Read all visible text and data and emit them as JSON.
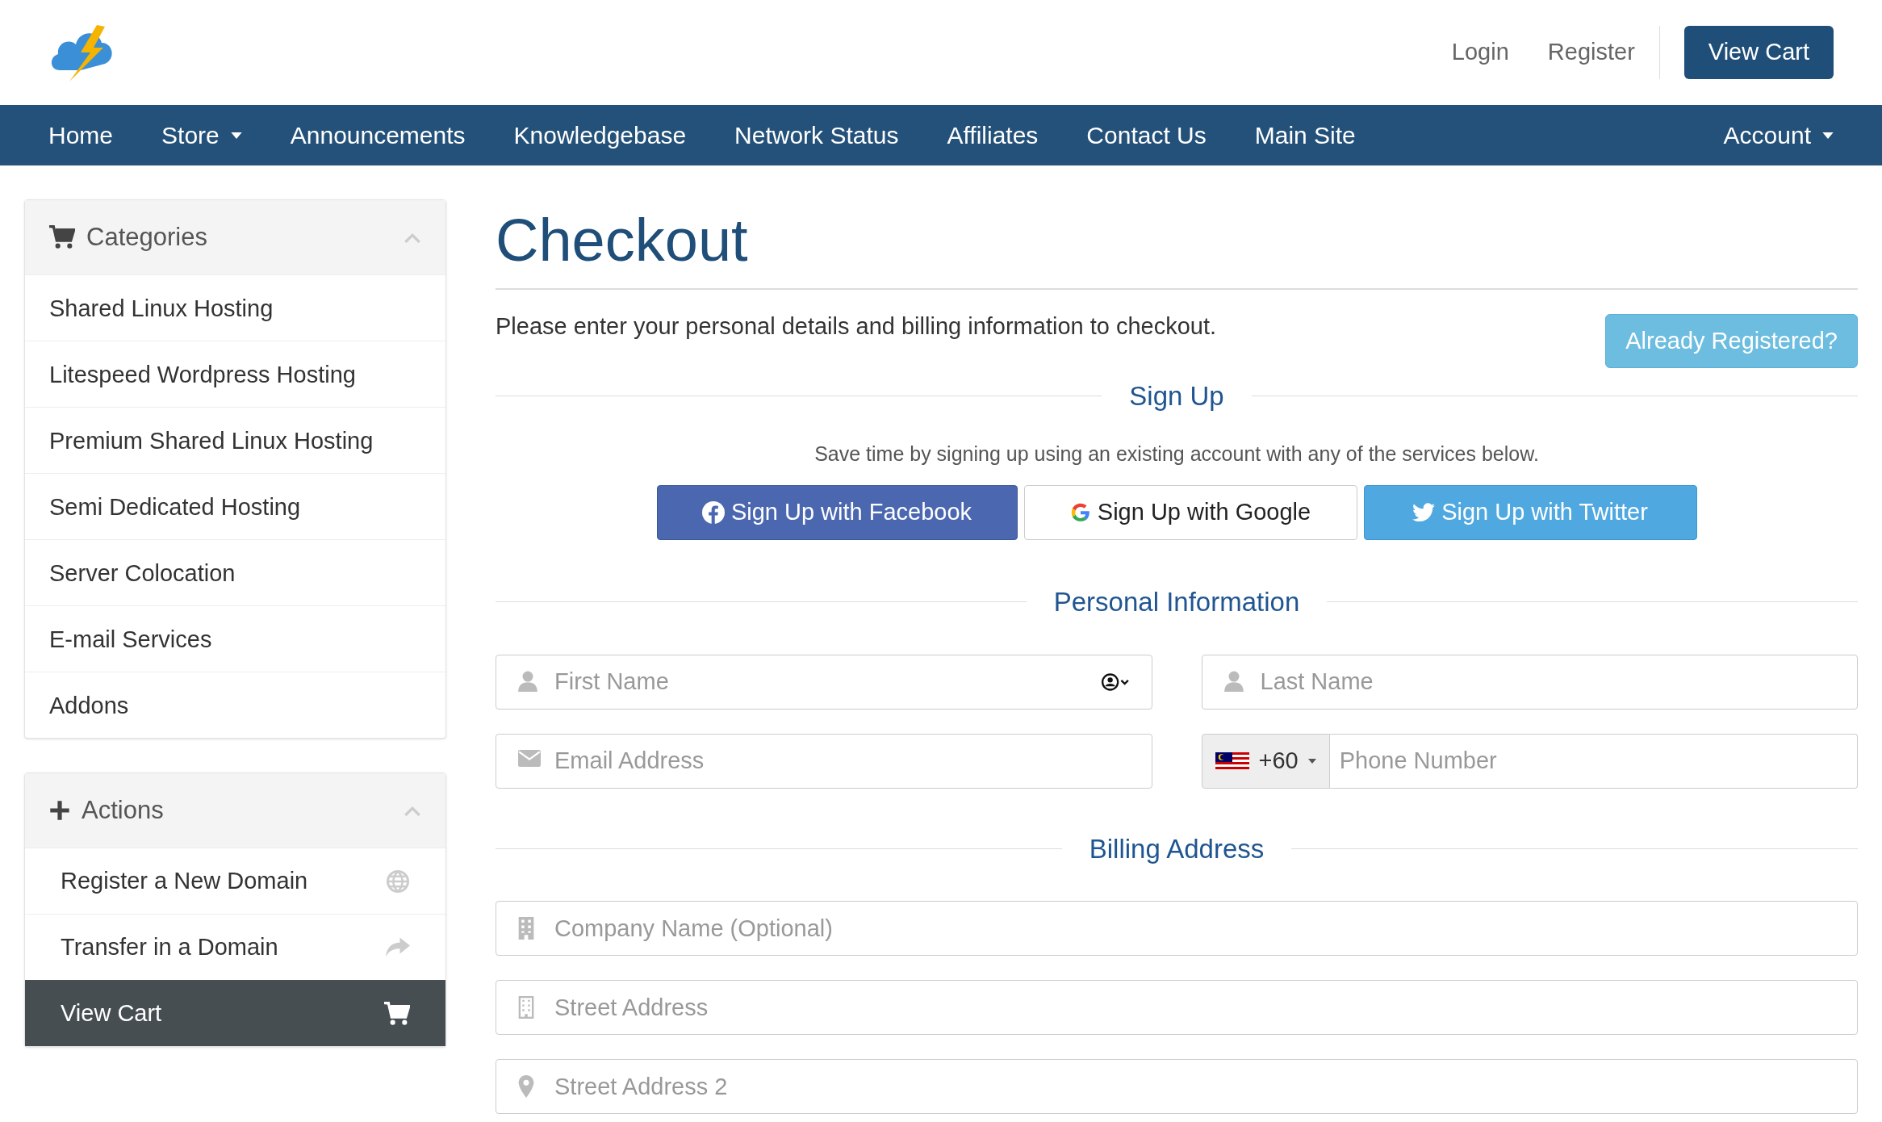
{
  "header": {
    "links": [
      "Login",
      "Register"
    ],
    "cart_button": "View Cart"
  },
  "nav": {
    "items": [
      {
        "label": "Home",
        "has_menu": false
      },
      {
        "label": "Store",
        "has_menu": true
      },
      {
        "label": "Announcements",
        "has_menu": false
      },
      {
        "label": "Knowledgebase",
        "has_menu": false
      },
      {
        "label": "Network Status",
        "has_menu": false
      },
      {
        "label": "Affiliates",
        "has_menu": false
      },
      {
        "label": "Contact Us",
        "has_menu": false
      },
      {
        "label": "Main Site",
        "has_menu": false
      }
    ],
    "account": {
      "label": "Account",
      "has_menu": true
    }
  },
  "sidebar": {
    "categories": {
      "title": "Categories",
      "items": [
        "Shared Linux Hosting",
        "Litespeed Wordpress Hosting",
        "Premium Shared Linux Hosting",
        "Semi Dedicated Hosting",
        "Server Colocation",
        "E-mail Services",
        "Addons"
      ]
    },
    "actions": {
      "title": "Actions",
      "items": [
        {
          "label": "Register a New Domain",
          "kind": "globe",
          "active": false
        },
        {
          "label": "Transfer in a Domain",
          "kind": "share",
          "active": false
        },
        {
          "label": "View Cart",
          "kind": "cart",
          "active": true
        }
      ]
    }
  },
  "main": {
    "title": "Checkout",
    "intro": "Please enter your personal details and billing information to checkout.",
    "already_registered": "Already Registered?",
    "sign_up": {
      "heading": "Sign Up",
      "note": "Save time by signing up using an existing account with any of the services below.",
      "buttons": [
        {
          "label": "Sign Up with Facebook",
          "kind": "facebook"
        },
        {
          "label": "Sign Up with Google",
          "kind": "google"
        },
        {
          "label": "Sign Up with Twitter",
          "kind": "twitter"
        }
      ]
    },
    "personal": {
      "heading": "Personal Information",
      "fields": [
        {
          "placeholder": "First Name",
          "kind": "person-autofill"
        },
        {
          "placeholder": "Last Name",
          "kind": "person"
        },
        {
          "placeholder": "Email Address",
          "kind": "email"
        },
        {
          "placeholder": "Phone Number",
          "kind": "phone",
          "country_code": "+60"
        }
      ]
    },
    "billing": {
      "heading": "Billing Address",
      "fields": [
        {
          "placeholder": "Company Name (Optional)",
          "kind": "company"
        },
        {
          "placeholder": "Street Address",
          "kind": "street"
        },
        {
          "placeholder": "Street Address 2",
          "kind": "pin"
        }
      ]
    }
  }
}
